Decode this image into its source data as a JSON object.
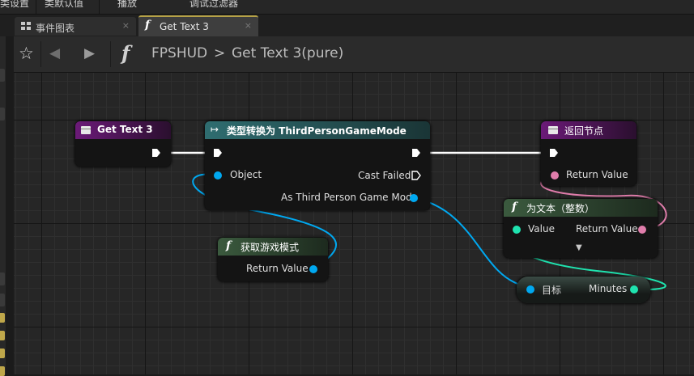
{
  "menu": {
    "items": [
      "类设置",
      "类默认值",
      "播放",
      "调试过滤器"
    ]
  },
  "tabs": [
    {
      "label": "事件图表",
      "close": "×"
    },
    {
      "label": "Get Text 3",
      "close": "×"
    }
  ],
  "breadcrumb": {
    "star": "☆",
    "back": "◀",
    "forward": "▶",
    "fn": "f",
    "parent": "FPSHUD",
    "sep": ">",
    "current": "Get Text 3(pure)"
  },
  "nodes": {
    "entry": {
      "title": "Get Text 3"
    },
    "cast": {
      "arrow": "↦",
      "title": "类型转换为 ThirdPersonGameMode",
      "object": "Object",
      "cast_failed": "Cast Failed",
      "as_pin": "As Third Person Game Mode"
    },
    "ret": {
      "title": "返回节点",
      "return_value": "Return Value"
    },
    "gamemode": {
      "fn": "f",
      "title": "获取游戏模式",
      "return_value": "Return Value"
    },
    "totext": {
      "fn": "f",
      "title": "为文本（整数）",
      "value": "Value",
      "return_value": "Return Value",
      "expand": "▼"
    },
    "minutes": {
      "target": "目标",
      "minutes": "Minutes"
    }
  },
  "colors": {
    "exec_wire": "#ffffff",
    "object_pin": "#00a8f0",
    "text_pin": "#e07dab",
    "int_pin": "#1fe3af",
    "entry_header": "#6b1a78",
    "cast_header": "#2f6d70",
    "pure_header": "#3b5a3e"
  }
}
